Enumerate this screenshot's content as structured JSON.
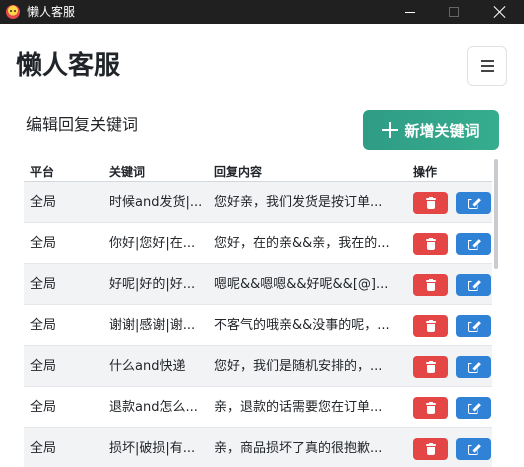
{
  "window": {
    "title": "懒人客服",
    "controls": {
      "minimize": "minimize",
      "maximize": "maximize",
      "close": "close"
    }
  },
  "header": {
    "brand": "懒人客服",
    "menu_icon": "hamburger-menu-icon"
  },
  "section": {
    "title": "编辑回复关键词",
    "add_button_label": "新增关键词"
  },
  "table": {
    "headers": {
      "platform": "平台",
      "keyword": "关键词",
      "reply": "回复内容",
      "ops": "操作"
    },
    "rows": [
      {
        "platform": "全局",
        "keyword": "时候and发货|...",
        "reply": "您好亲，我们发货是按订单..."
      },
      {
        "platform": "全局",
        "keyword": "你好|您好|在...",
        "reply": "您好，在的亲&&亲，我在的..."
      },
      {
        "platform": "全局",
        "keyword": "好呢|好的|好...",
        "reply": "嗯呢&&嗯嗯&&好呢&&[@]..."
      },
      {
        "platform": "全局",
        "keyword": "谢谢|感谢|谢...",
        "reply": "不客气的哦亲&&没事的呢，..."
      },
      {
        "platform": "全局",
        "keyword": "什么and快递",
        "reply": "您好，我们是随机安排的，..."
      },
      {
        "platform": "全局",
        "keyword": "退款and怎么...",
        "reply": "亲，退款的话需要您在订单..."
      },
      {
        "platform": "全局",
        "keyword": "损坏|破损|有...",
        "reply": "亲，商品损坏了真的很抱歉..."
      }
    ]
  },
  "colors": {
    "titlebar": "#202020",
    "add_button": "#2f9c86",
    "delete_button": "#e44646",
    "edit_button": "#2f82d6",
    "stripe": "#f2f3f5"
  }
}
